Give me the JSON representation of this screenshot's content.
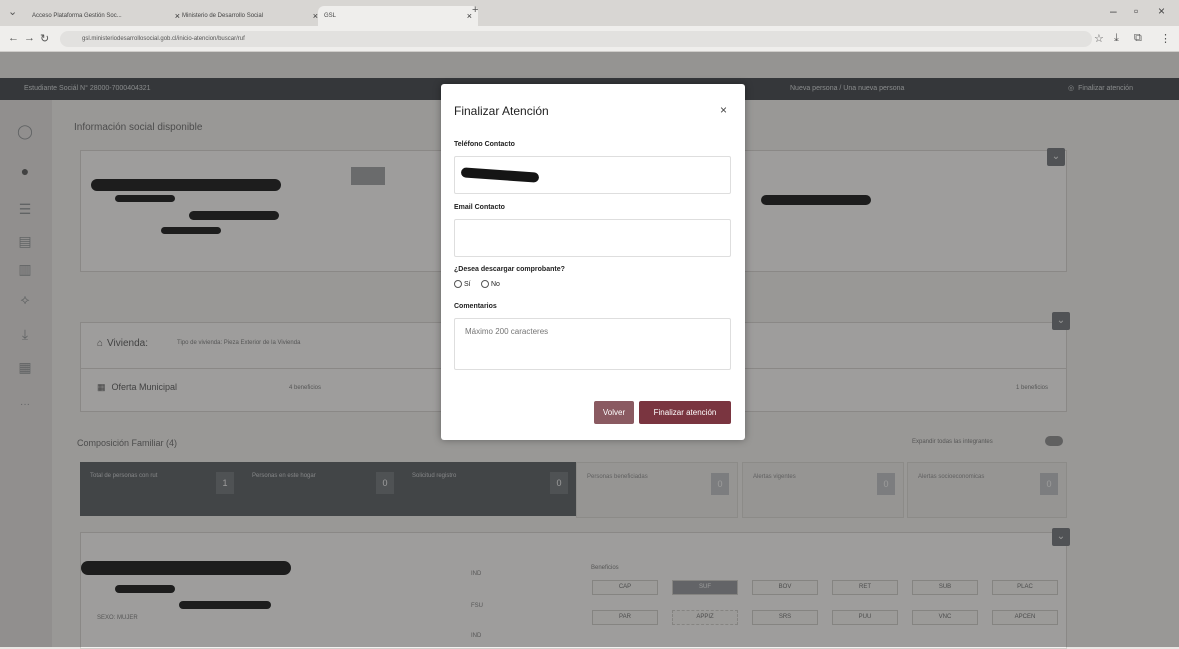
{
  "browser": {
    "tabs": [
      {
        "label": "Acceso Plataforma Gestión Soc..."
      },
      {
        "label": "Ministerio de Desarrollo Social"
      },
      {
        "label": "GSL"
      }
    ],
    "url": "gsl.ministeriodesarrollosocial.gob.cl/inicio-atencion/buscar/ruf"
  },
  "app": {
    "header_left": "Estudiante Sociál N° 28000-7000404321",
    "header_center": "Nueva persona / Una nueva persona",
    "header_right": "Finalizar atención",
    "section_title": "Información social disponible",
    "vivienda_label": "Vivienda:",
    "vivienda_detail": "Tipo de vivienda: Pieza Exterior de la Vivienda",
    "oferta_label": "Oferta Municipal",
    "oferta_tag": "4 beneficios",
    "oferta_right_tag": "1 beneficios",
    "composicion_title": "Composición Familiar (4)",
    "composicion_right": "Expandir todas las integrantes",
    "stats": [
      {
        "label": "Total de personas con rut",
        "value": "1"
      },
      {
        "label": "Personas en este hogar",
        "value": "0"
      },
      {
        "label": "Solicitud registro",
        "value": "0"
      },
      {
        "label": "Personas beneficiadas",
        "value": "0"
      },
      {
        "label": "Alertas vigentes",
        "value": "0"
      },
      {
        "label": "Alertas socioeconomicas",
        "value": "0"
      }
    ],
    "beneficios_label": "Beneficios",
    "beneficio_tags": [
      "CAP",
      "SUF",
      "BOV",
      "RET",
      "SUB",
      "PLAC"
    ],
    "beneficio_tags2": [
      "PAR",
      "APPIZ",
      "SRS",
      "PUU",
      "VNC",
      "APCEN"
    ],
    "row_labels": [
      "IND",
      "FSU",
      "IND"
    ],
    "sexo": "SEXO: MUJER"
  },
  "modal": {
    "title": "Finalizar Atención",
    "telefono_label": "Teléfono Contacto",
    "email_label": "Email Contacto",
    "email_value": "",
    "descargar_label": "¿Desea descargar comprobante?",
    "opt_si": "Sí",
    "opt_no": "No",
    "comentarios_label": "Comentarios",
    "comentarios_placeholder": "Máximo 200 caracteres",
    "btn_volver": "Volver",
    "btn_finalizar": "Finalizar atención"
  },
  "colors": {
    "primary": "#7a3540",
    "header_dark": "#3e4347"
  }
}
